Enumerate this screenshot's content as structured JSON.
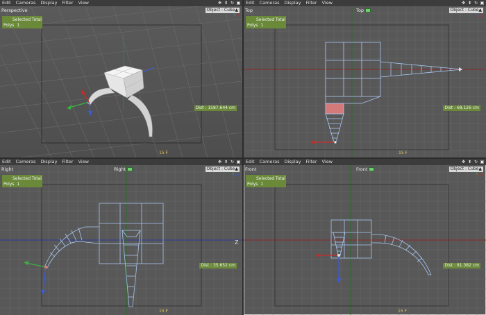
{
  "menu": [
    "Edit",
    "Cameras",
    "Display",
    "Filter",
    "View"
  ],
  "object_tag": "Object : Cube",
  "stats_title": "Selected Total",
  "polys_label": "Polys",
  "polys_value": "1",
  "frame": "15 F",
  "colors": {
    "grid": "#6a6a6a",
    "mesh": "#a9c7f0",
    "xaxis": "#8a2a2a",
    "yaxis": "#2a7a2a",
    "stats": "#6a8a3a",
    "selected": "#d47a7a"
  },
  "viewports": {
    "perspective": {
      "name": "Perspective",
      "distance": "Dist : 1587.644 cm"
    },
    "top": {
      "name": "Top",
      "center": "Top",
      "distance": "Dist : 68.126 cm"
    },
    "right": {
      "name": "Right",
      "center": "Right",
      "distance": "Dist : 35.652 cm",
      "axis_label": "Z"
    },
    "front": {
      "name": "Front",
      "center": "Front",
      "distance": "Dist : 81.382 cm"
    }
  }
}
